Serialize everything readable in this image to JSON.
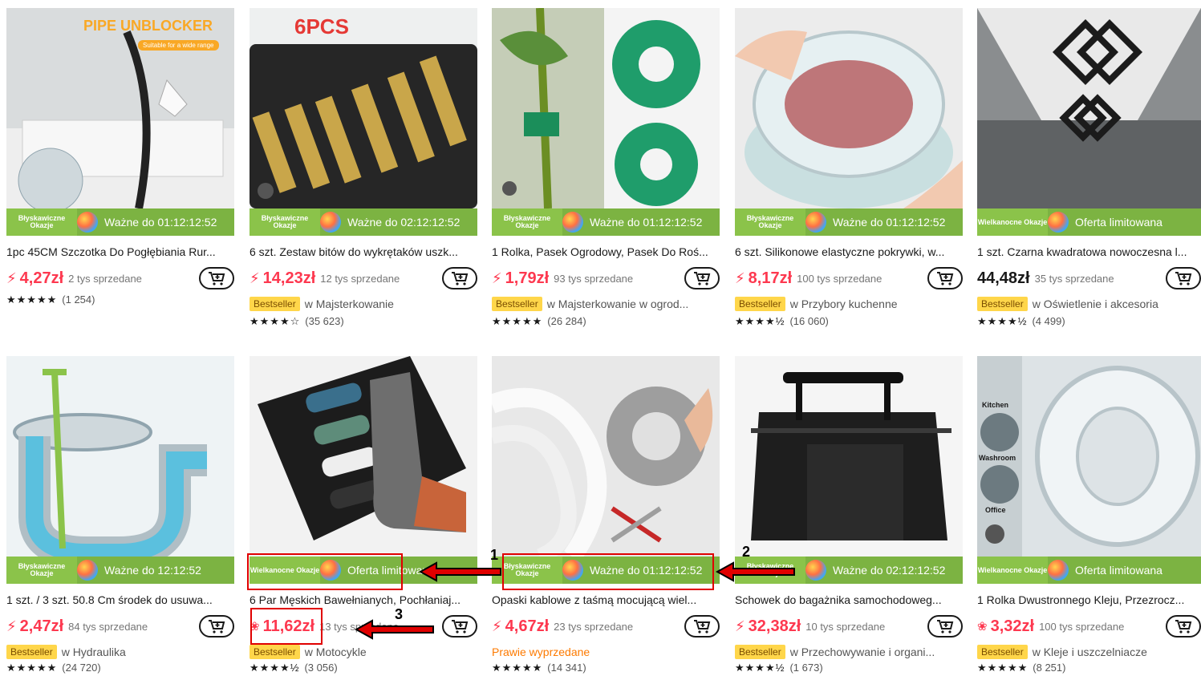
{
  "products": [
    {
      "title": "1pc 45CM Szczotka Do Pogłębiania Rur...",
      "price": "4,27zł",
      "price_icon": "bolt-icon",
      "sold": "2 tys sprzedane",
      "badge": "Błyskawiczne Okazje",
      "banner_text": "Ważne do 01:12:12:52",
      "meta_badge": "",
      "meta_text": "",
      "rating": 5.0,
      "reviews": "(1 254)",
      "image_text": "PIPE UNBLOCKER",
      "image_subtext": "Suitable for a wide range"
    },
    {
      "title": "6 szt. Zestaw bitów do wykrętaków uszk...",
      "price": "14,23zł",
      "price_icon": "bolt-icon",
      "sold": "12 tys sprzedane",
      "badge": "Błyskawiczne Okazje",
      "banner_text": "Ważne do 02:12:12:52",
      "meta_badge": "Bestseller",
      "meta_text": "w Majsterkowanie",
      "rating": 4.5,
      "reviews": "(35 623)",
      "image_text": "6PCS"
    },
    {
      "title": "1 Rolka, Pasek Ogrodowy, Pasek Do Roś...",
      "price": "1,79zł",
      "price_icon": "bolt-icon",
      "sold": "93 tys sprzedane",
      "badge": "Błyskawiczne Okazje",
      "banner_text": "Ważne do 01:12:12:52",
      "meta_badge": "Bestseller",
      "meta_text": "w Majsterkowanie w ogrod...",
      "rating": 5.0,
      "reviews": "(26 284)"
    },
    {
      "title": "6 szt. Silikonowe elastyczne pokrywki, w...",
      "price": "8,17zł",
      "price_icon": "bolt-icon",
      "sold": "100 tys sprzedane",
      "badge": "Błyskawiczne Okazje",
      "banner_text": "Ważne do 01:12:12:52",
      "meta_badge": "Bestseller",
      "meta_text": "w Przybory kuchenne",
      "rating": 4.5,
      "reviews": "(16 060)"
    },
    {
      "title": "1 szt. Czarna kwadratowa nowoczesna l...",
      "price": "44,48zł",
      "price_icon": "",
      "sold": "35 tys sprzedane",
      "badge": "Wielkanocne Okazje",
      "banner_text": "Oferta limitowana",
      "meta_badge": "Bestseller",
      "meta_text": "w Oświetlenie i akcesoria",
      "rating": 4.5,
      "reviews": "(4 499)"
    },
    {
      "title": "1 szt. / 3 szt. 50.8 Cm środek do usuwa...",
      "price": "2,47zł",
      "price_icon": "bolt-icon",
      "sold": "84 tys sprzedane",
      "badge": "Błyskawiczne Okazje",
      "banner_text": "Ważne do 12:12:52",
      "meta_badge": "Bestseller",
      "meta_text": "w Hydraulika",
      "rating": 5.0,
      "reviews": "(24 720)"
    },
    {
      "title": "6 Par Męskich Bawełnianych, Pochłaniaj...",
      "price": "11,62zł",
      "price_icon": "coin-icon",
      "sold": "13 tys sprzedane",
      "badge": "Wielkanocne Okazje",
      "banner_text": "Oferta limitowana",
      "meta_badge": "Bestseller",
      "meta_text": "w Motocykle",
      "rating": 4.5,
      "reviews": "(3 056)"
    },
    {
      "title": "Opaski kablowe z taśmą mocującą wiel...",
      "price": "4,67zł",
      "price_icon": "bolt-icon",
      "sold": "23 tys sprzedane",
      "badge": "Błyskawiczne Okazje",
      "banner_text": "Ważne do 01:12:12:52",
      "meta_badge": "",
      "meta_text": "Prawie wyprzedane",
      "rating": 5.0,
      "reviews": "(14 341)"
    },
    {
      "title": "Schowek do bagażnika samochodoweg...",
      "price": "32,38zł",
      "price_icon": "bolt-icon",
      "sold": "10 tys sprzedane",
      "badge": "Błyskawiczne Okazje",
      "banner_text": "Ważne do 02:12:12:52",
      "meta_badge": "Bestseller",
      "meta_text": "w Przechowywanie i organi...",
      "rating": 4.5,
      "reviews": "(1 673)"
    },
    {
      "title": "1 Rolka Dwustronnego Kleju, Przezrocz...",
      "price": "3,32zł",
      "price_icon": "coin-icon",
      "sold": "100 tys sprzedane",
      "badge": "Wielkanocne Okazje",
      "banner_text": "Oferta limitowana",
      "meta_badge": "Bestseller",
      "meta_text": "w Kleje i uszczelniacze",
      "rating": 5.0,
      "reviews": "(8 251)",
      "image_labels": [
        "Kitchen",
        "Washroom",
        "Office"
      ]
    }
  ],
  "annotations": [
    "1",
    "2",
    "3"
  ],
  "colors": {
    "price_red": "#fd384f",
    "banner_green": "#7cb342",
    "annotation_red": "#e00000",
    "bestseller_yellow": "#ffd64a"
  }
}
